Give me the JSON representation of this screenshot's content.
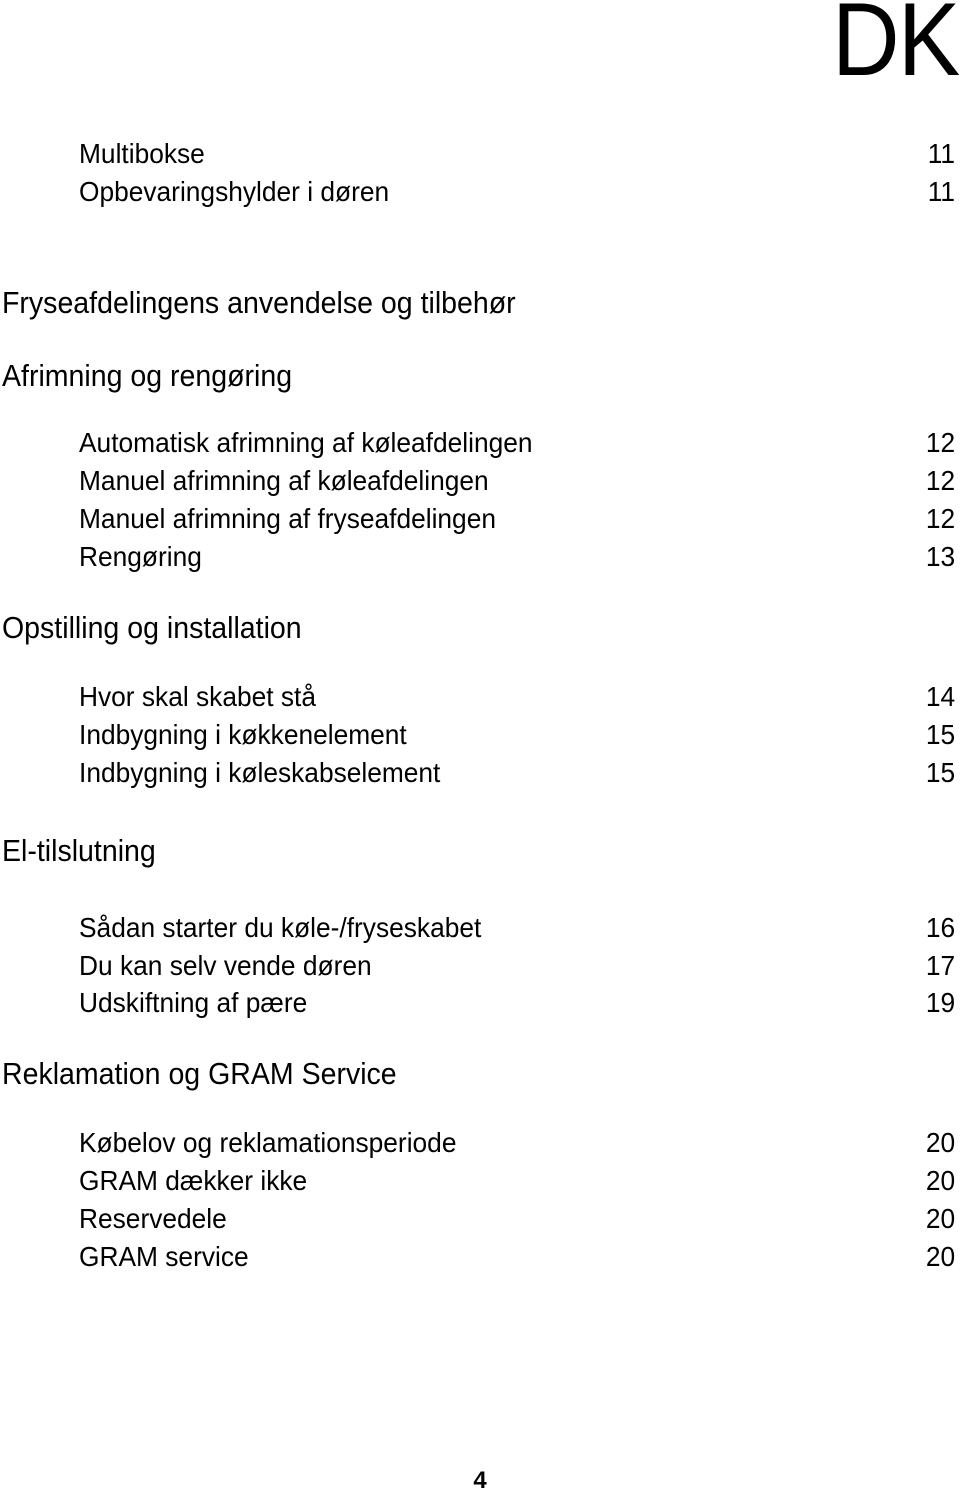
{
  "header": {
    "language_code": "DK"
  },
  "toc": {
    "intro_entries": [
      {
        "title": "Multibokse",
        "page": "11"
      },
      {
        "title": "Opbevaringshylder i døren",
        "page": "11"
      }
    ],
    "sections": [
      {
        "heading": "Fryseafdelingens anvendelse og tilbehør",
        "entries": []
      },
      {
        "heading": "Afrimning og rengøring",
        "entries": [
          {
            "title": "Automatisk afrimning af køleafdelingen",
            "page": "12"
          },
          {
            "title": "Manuel afrimning af køleafdelingen",
            "page": "12"
          },
          {
            "title": "Manuel afrimning af fryseafdelingen",
            "page": "12"
          },
          {
            "title": "Rengøring",
            "page": "13"
          }
        ]
      },
      {
        "heading": "Opstilling og installation",
        "entries": [
          {
            "title": "Hvor skal skabet stå",
            "page": "14"
          },
          {
            "title": "Indbygning i køkkenelement",
            "page": "15"
          },
          {
            "title": "Indbygning i køleskabselement",
            "page": "15"
          }
        ]
      },
      {
        "heading": "El-tilslutning",
        "entries": [
          {
            "title": "Sådan starter du køle-/fryseskabet",
            "page": "16"
          },
          {
            "title": "Du kan selv vende døren",
            "page": "17"
          },
          {
            "title": "Udskiftning af pære",
            "page": "19"
          }
        ]
      },
      {
        "heading": "Reklamation og GRAM Service",
        "entries": [
          {
            "title": "Købelov og reklamationsperiode",
            "page": "20"
          },
          {
            "title": "GRAM dækker ikke",
            "page": "20"
          },
          {
            "title": "Reservedele",
            "page": "20"
          },
          {
            "title": "GRAM service",
            "page": "20"
          }
        ]
      }
    ]
  },
  "footer": {
    "page_number": "4"
  }
}
